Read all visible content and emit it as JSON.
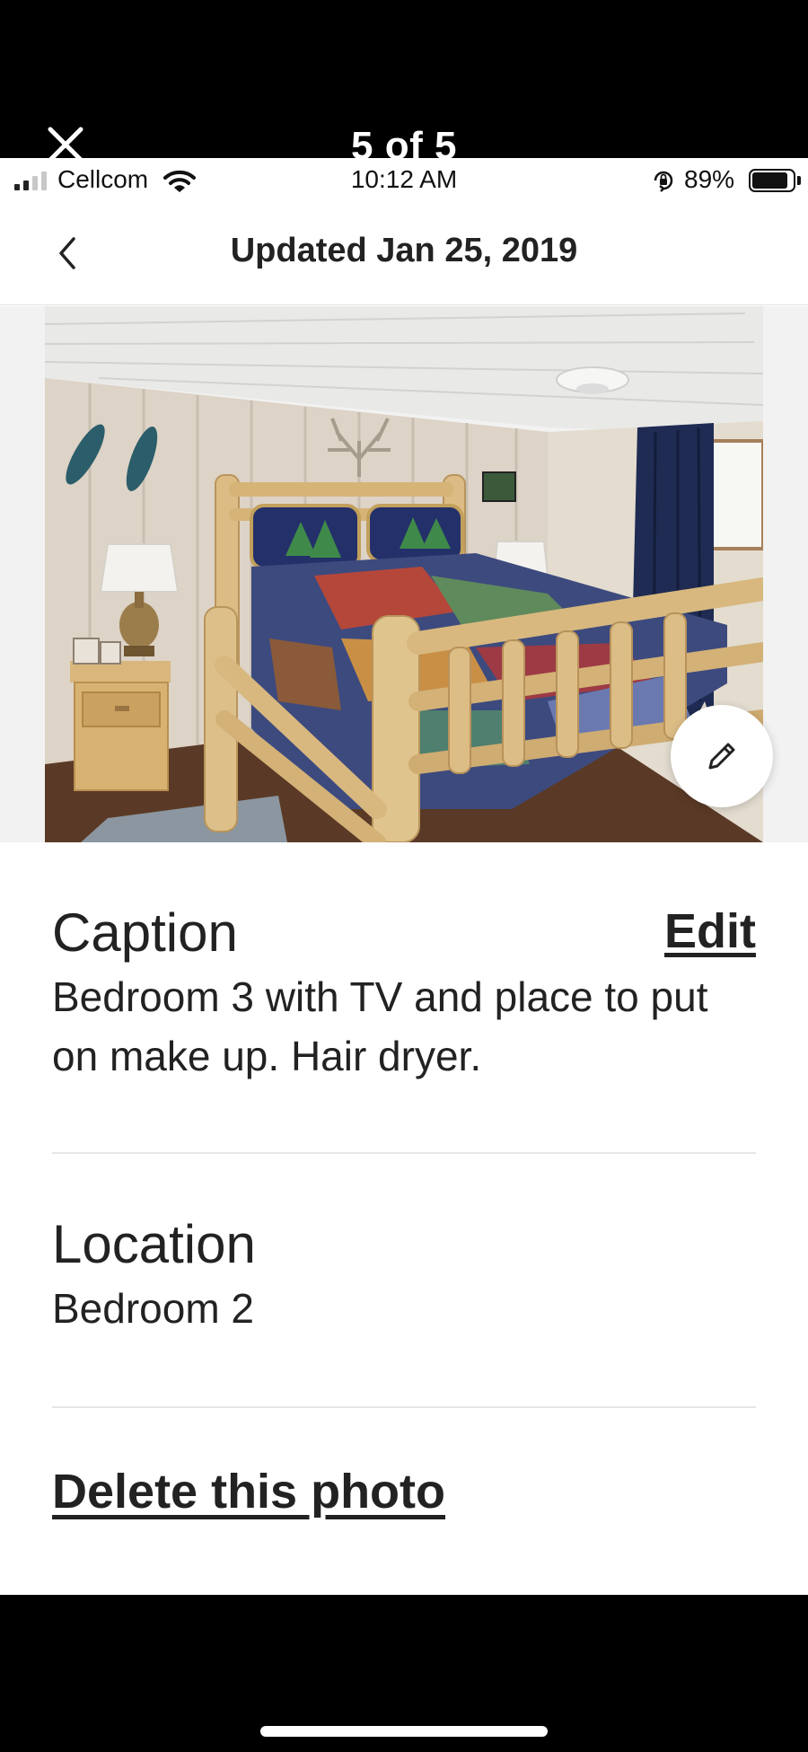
{
  "viewer": {
    "close_icon": "close-icon",
    "counter": "5 of 5"
  },
  "status_bar": {
    "carrier": "Cellcom",
    "time": "10:12 AM",
    "battery": "89%",
    "battery_level": 0.89
  },
  "nav": {
    "back_icon": "chevron-left-icon",
    "title": "Updated Jan 25, 2019"
  },
  "photo": {
    "edit_icon": "pencil-icon"
  },
  "caption": {
    "title": "Caption",
    "edit_label": "Edit",
    "text": "Bedroom 3 with TV and place to put on make up. Hair dryer."
  },
  "location": {
    "title": "Location",
    "value": "Bedroom 2"
  },
  "actions": {
    "delete_label": "Delete this photo"
  }
}
